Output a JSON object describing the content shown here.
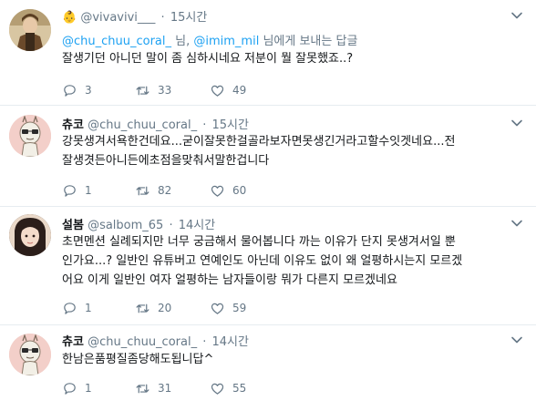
{
  "tweets": [
    {
      "display_name": "👶",
      "handle": "@vivavivi___",
      "time": "15시간",
      "reply_to": {
        "user1": "@chu_chuu_coral_",
        "sep": " 님, ",
        "user2": "@imim_mil",
        "suffix": " 님에게 보내는 답글"
      },
      "text": [
        "잘생기던 아니던 말이 좀 심하시네요 저분이 뭘 잘못했죠..?"
      ],
      "replies": "3",
      "retweets": "33",
      "likes": "49"
    },
    {
      "display_name": "츄코",
      "handle": "@chu_chuu_coral_",
      "time": "15시간",
      "text": [
        "강못생겨서욕한건데요...굳이잘못한걸골라보자면못생긴거라고할수잇겟네요...전",
        "잘생겻든아니든에초점을맞춰서말한겁니다"
      ],
      "replies": "1",
      "retweets": "82",
      "likes": "60"
    },
    {
      "display_name": "설봄",
      "handle": "@salbom_65",
      "time": "14시간",
      "text": [
        "초면멘션 실례되지만 너무 궁금해서 물어봅니다 까는 이유가 단지 못생겨서일 뿐",
        "인가요...? 일반인 유튜버고 연예인도 아닌데 이유도 없이 왜 얼평하시는지 모르겠",
        "어요 이게 일반인 여자 얼평하는 남자들이랑 뭐가 다른지 모르겠네요"
      ],
      "replies": "1",
      "retweets": "20",
      "likes": "59"
    },
    {
      "display_name": "츄코",
      "handle": "@chu_chuu_coral_",
      "time": "14시간",
      "text": [
        "한남은품평질좀당해도됩니답^"
      ],
      "replies": "1",
      "retweets": "31",
      "likes": "55"
    }
  ],
  "colors": {
    "text": "#14171a",
    "secondary": "#657786",
    "link": "#1da1f2",
    "divider": "#e6ecf0",
    "avatar_1": "#8a6a3f",
    "avatar_2": "#f3cfc9",
    "avatar_3": "#3a2d2a"
  },
  "icons": {
    "reply": "speech-bubble-icon",
    "retweet": "retweet-arrows-icon",
    "like": "heart-outline-icon",
    "more": "chevron-down-icon"
  }
}
